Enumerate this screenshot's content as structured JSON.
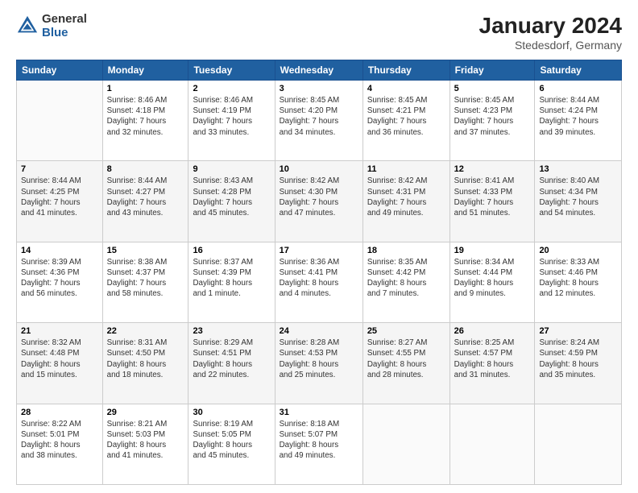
{
  "logo": {
    "general": "General",
    "blue": "Blue"
  },
  "header": {
    "title": "January 2024",
    "subtitle": "Stedesdorf, Germany"
  },
  "weekdays": [
    "Sunday",
    "Monday",
    "Tuesday",
    "Wednesday",
    "Thursday",
    "Friday",
    "Saturday"
  ],
  "weeks": [
    [
      {
        "day": "",
        "info": ""
      },
      {
        "day": "1",
        "info": "Sunrise: 8:46 AM\nSunset: 4:18 PM\nDaylight: 7 hours\nand 32 minutes."
      },
      {
        "day": "2",
        "info": "Sunrise: 8:46 AM\nSunset: 4:19 PM\nDaylight: 7 hours\nand 33 minutes."
      },
      {
        "day": "3",
        "info": "Sunrise: 8:45 AM\nSunset: 4:20 PM\nDaylight: 7 hours\nand 34 minutes."
      },
      {
        "day": "4",
        "info": "Sunrise: 8:45 AM\nSunset: 4:21 PM\nDaylight: 7 hours\nand 36 minutes."
      },
      {
        "day": "5",
        "info": "Sunrise: 8:45 AM\nSunset: 4:23 PM\nDaylight: 7 hours\nand 37 minutes."
      },
      {
        "day": "6",
        "info": "Sunrise: 8:44 AM\nSunset: 4:24 PM\nDaylight: 7 hours\nand 39 minutes."
      }
    ],
    [
      {
        "day": "7",
        "info": "Sunrise: 8:44 AM\nSunset: 4:25 PM\nDaylight: 7 hours\nand 41 minutes."
      },
      {
        "day": "8",
        "info": "Sunrise: 8:44 AM\nSunset: 4:27 PM\nDaylight: 7 hours\nand 43 minutes."
      },
      {
        "day": "9",
        "info": "Sunrise: 8:43 AM\nSunset: 4:28 PM\nDaylight: 7 hours\nand 45 minutes."
      },
      {
        "day": "10",
        "info": "Sunrise: 8:42 AM\nSunset: 4:30 PM\nDaylight: 7 hours\nand 47 minutes."
      },
      {
        "day": "11",
        "info": "Sunrise: 8:42 AM\nSunset: 4:31 PM\nDaylight: 7 hours\nand 49 minutes."
      },
      {
        "day": "12",
        "info": "Sunrise: 8:41 AM\nSunset: 4:33 PM\nDaylight: 7 hours\nand 51 minutes."
      },
      {
        "day": "13",
        "info": "Sunrise: 8:40 AM\nSunset: 4:34 PM\nDaylight: 7 hours\nand 54 minutes."
      }
    ],
    [
      {
        "day": "14",
        "info": "Sunrise: 8:39 AM\nSunset: 4:36 PM\nDaylight: 7 hours\nand 56 minutes."
      },
      {
        "day": "15",
        "info": "Sunrise: 8:38 AM\nSunset: 4:37 PM\nDaylight: 7 hours\nand 58 minutes."
      },
      {
        "day": "16",
        "info": "Sunrise: 8:37 AM\nSunset: 4:39 PM\nDaylight: 8 hours\nand 1 minute."
      },
      {
        "day": "17",
        "info": "Sunrise: 8:36 AM\nSunset: 4:41 PM\nDaylight: 8 hours\nand 4 minutes."
      },
      {
        "day": "18",
        "info": "Sunrise: 8:35 AM\nSunset: 4:42 PM\nDaylight: 8 hours\nand 7 minutes."
      },
      {
        "day": "19",
        "info": "Sunrise: 8:34 AM\nSunset: 4:44 PM\nDaylight: 8 hours\nand 9 minutes."
      },
      {
        "day": "20",
        "info": "Sunrise: 8:33 AM\nSunset: 4:46 PM\nDaylight: 8 hours\nand 12 minutes."
      }
    ],
    [
      {
        "day": "21",
        "info": "Sunrise: 8:32 AM\nSunset: 4:48 PM\nDaylight: 8 hours\nand 15 minutes."
      },
      {
        "day": "22",
        "info": "Sunrise: 8:31 AM\nSunset: 4:50 PM\nDaylight: 8 hours\nand 18 minutes."
      },
      {
        "day": "23",
        "info": "Sunrise: 8:29 AM\nSunset: 4:51 PM\nDaylight: 8 hours\nand 22 minutes."
      },
      {
        "day": "24",
        "info": "Sunrise: 8:28 AM\nSunset: 4:53 PM\nDaylight: 8 hours\nand 25 minutes."
      },
      {
        "day": "25",
        "info": "Sunrise: 8:27 AM\nSunset: 4:55 PM\nDaylight: 8 hours\nand 28 minutes."
      },
      {
        "day": "26",
        "info": "Sunrise: 8:25 AM\nSunset: 4:57 PM\nDaylight: 8 hours\nand 31 minutes."
      },
      {
        "day": "27",
        "info": "Sunrise: 8:24 AM\nSunset: 4:59 PM\nDaylight: 8 hours\nand 35 minutes."
      }
    ],
    [
      {
        "day": "28",
        "info": "Sunrise: 8:22 AM\nSunset: 5:01 PM\nDaylight: 8 hours\nand 38 minutes."
      },
      {
        "day": "29",
        "info": "Sunrise: 8:21 AM\nSunset: 5:03 PM\nDaylight: 8 hours\nand 41 minutes."
      },
      {
        "day": "30",
        "info": "Sunrise: 8:19 AM\nSunset: 5:05 PM\nDaylight: 8 hours\nand 45 minutes."
      },
      {
        "day": "31",
        "info": "Sunrise: 8:18 AM\nSunset: 5:07 PM\nDaylight: 8 hours\nand 49 minutes."
      },
      {
        "day": "",
        "info": ""
      },
      {
        "day": "",
        "info": ""
      },
      {
        "day": "",
        "info": ""
      }
    ]
  ]
}
